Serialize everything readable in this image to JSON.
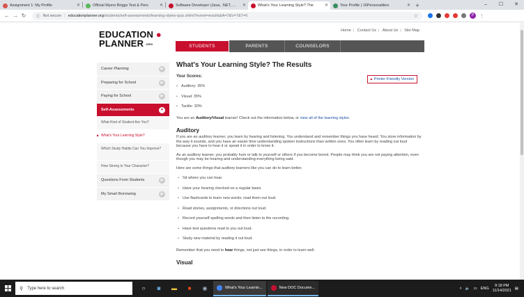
{
  "browser": {
    "tabs": [
      {
        "title": "Assignment 1: My Profile",
        "color": "#d9534f"
      },
      {
        "title": "Official Myers Briggs Test & Pers",
        "color": "#5cb85c"
      },
      {
        "title": "Software Developer (Java, .NET, ...",
        "color": "#c8102e"
      },
      {
        "title": "What's Your Learning Style? The",
        "color": "#c8102e",
        "active": true
      },
      {
        "title": "Your Profile | 16Personalities",
        "color": "#3b8d5e"
      }
    ],
    "new_tab": "+",
    "address": {
      "security": "Not secure",
      "host": "educationplanner.org",
      "path": "/students/self-assessments/learning-styles-quiz.shtml?event=results&A=7&V=7&T=6"
    }
  },
  "site": {
    "logo_line1": "EDUCATION",
    "logo_line2": "PLANNER",
    "logo_sub": ".ORG",
    "toplinks": [
      "Home",
      "Contact Us",
      "About Us",
      "Site Map"
    ],
    "nav": {
      "students": "STUDENTS",
      "parents": "PARENTS",
      "counselors": "COUNSELORS"
    }
  },
  "sidebar": {
    "items": [
      {
        "label": "Career Planning"
      },
      {
        "label": "Preparing for School"
      },
      {
        "label": "Paying for School"
      },
      {
        "label": "Self-Assessments"
      }
    ],
    "subitems": [
      "What Kind of Student Are You?",
      "What's Your Learning Style?",
      "Which Study Habits Can You Improve?",
      "How Strong Is Your Character?"
    ],
    "items_after": [
      {
        "label": "Questions From Students"
      },
      {
        "label": "My Smart Borrowing"
      }
    ]
  },
  "content": {
    "title": "What's Your Learning Style? The Results",
    "scores_label": "Your Scores:",
    "printer": "Printer Friendly Version",
    "scores": [
      "Auditory: 35%",
      "Visual: 35%",
      "Tactile: 30%"
    ],
    "result_pre": "You are an ",
    "result_bold": "Auditory/Visual",
    "result_mid": " learner! Check out the information below, or ",
    "result_link": "view all of the learning styles",
    "result_end": ".",
    "auditory_heading": "Auditory",
    "auditory_p1": "If you are an auditory learner, you learn by hearing and listening. You understand and remember things you have heard. You store information by the way it sounds, and you have an easier time understanding spoken instructions than written ones. You often learn by reading out loud because you have to hear it or speak it in order to know it.",
    "auditory_p2": "As an auditory learner, you probably hum or talk to yourself or others if you become bored. People may think you are not paying attention, even though you may be hearing and understanding everything being said.",
    "auditory_p3": "Here are some things that auditory learners like you can do to learn better.",
    "tips": [
      "Sit where you can hear.",
      "Have your hearing checked on a regular basis.",
      "Use flashcards to learn new words; read them out loud.",
      "Read stories, assignments, or directions out loud.",
      "Record yourself spelling words and then listen to the recording.",
      "Have test questions read to you out loud.",
      "Study new material by reading it out loud."
    ],
    "remember_pre": "Remember that you need to ",
    "remember_bold": "hear",
    "remember_post": " things, not just see things, in order to learn well.",
    "visual_heading": "Visual"
  },
  "taskbar": {
    "search_placeholder": "Type here to search",
    "apps": [
      {
        "label": "What's Your Learnin...",
        "color": "#4285f4"
      },
      {
        "label": "New DOC Docume...",
        "color": "#c8102e"
      }
    ],
    "lang": "ENG",
    "time": "9:18 PM",
    "date": "11/14/2021"
  }
}
